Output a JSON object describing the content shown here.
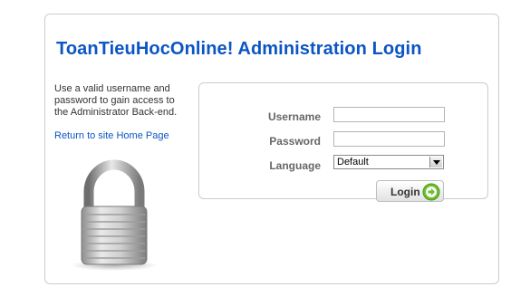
{
  "login": {
    "title": "ToanTieuHocOnline! Administration Login",
    "intro_text": "Use a valid username and password to gain access to the Administrator Back-end.",
    "home_link": "Return to site Home Page",
    "username_label": "Username",
    "username_value": "",
    "password_label": "Password",
    "password_value": "",
    "language_label": "Language",
    "language_selected": "Default",
    "login_button": "Login"
  },
  "colors": {
    "title": "#0b55c4",
    "link": "#0b55c4",
    "label": "#666666",
    "login_icon": "#6cbf2b"
  },
  "icons": [
    "padlock-icon",
    "chevron-down-icon",
    "arrow-right-icon"
  ]
}
